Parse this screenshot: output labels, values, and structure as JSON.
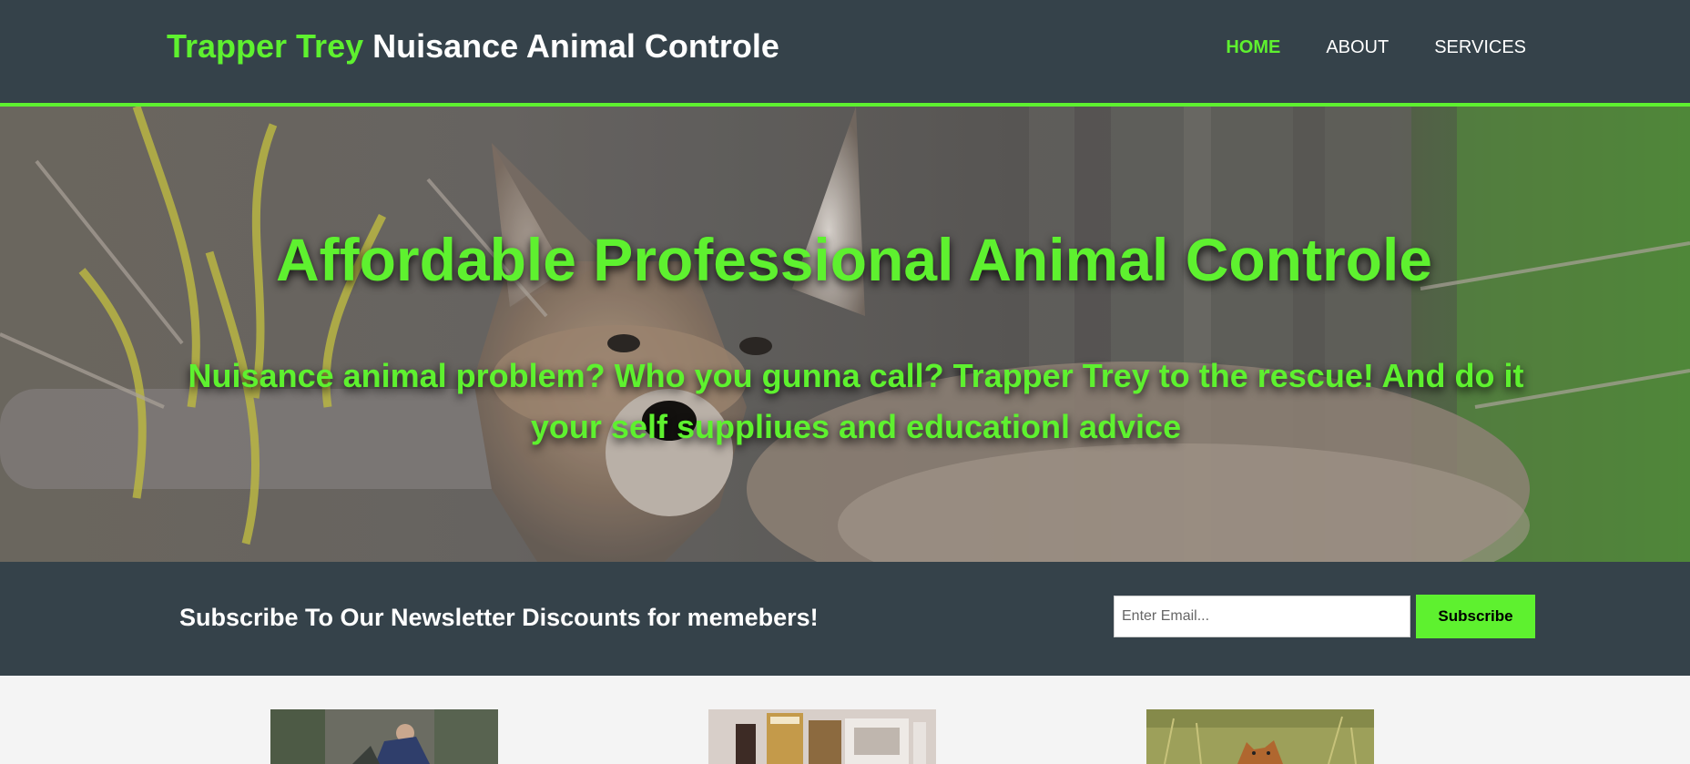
{
  "header": {
    "brand_highlight": "Trapper Trey",
    "brand_rest": "Nuisance Animal Controle",
    "nav": [
      {
        "label": "HOME",
        "current": true
      },
      {
        "label": "ABOUT",
        "current": false
      },
      {
        "label": "SERVICES",
        "current": false
      }
    ]
  },
  "showcase": {
    "title": "Affordable Professional Animal Controle",
    "subtitle": "Nuisance animal problem? Who you gunna call? Trapper Trey to the rescue! And do it your self suppliues and educationl advice"
  },
  "newsletter": {
    "title": "Subscribe To Our Newsletter Discounts for memebers!",
    "email_placeholder": "Enter Email...",
    "button_label": "Subscribe"
  },
  "colors": {
    "accent": "#5ef12f",
    "dark": "#35424a",
    "light_bg": "#f4f4f4"
  },
  "icons": {
    "hero_image": "coyote-photo",
    "box_images": [
      "trapper-photo",
      "supplies-photo",
      "fox-photo"
    ]
  }
}
